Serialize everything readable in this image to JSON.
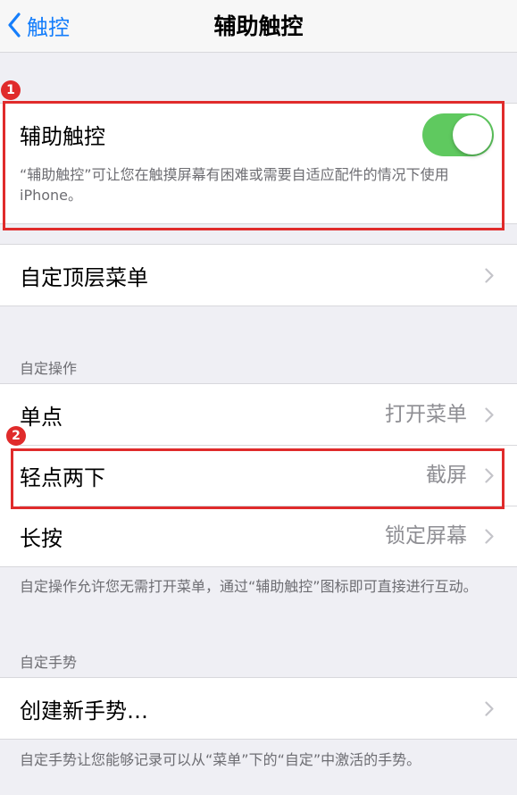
{
  "nav": {
    "back_label": "触控",
    "title": "辅助触控"
  },
  "assistive_touch": {
    "label": "辅助触控",
    "enabled": true,
    "footnote": "“辅助触控”可让您在触摸屏幕有困难或需要自适应配件的情况下使用iPhone。"
  },
  "top_menu": {
    "label": "自定顶层菜单"
  },
  "custom_actions": {
    "header": "自定操作",
    "rows": [
      {
        "label": "单点",
        "value": "打开菜单"
      },
      {
        "label": "轻点两下",
        "value": "截屏"
      },
      {
        "label": "长按",
        "value": "锁定屏幕"
      }
    ],
    "footnote": "自定操作允许您无需打开菜单，通过“辅助触控”图标即可直接进行互动。"
  },
  "custom_gestures": {
    "header": "自定手势",
    "create_label": "创建新手势…",
    "footnote": "自定手势让您能够记录可以从“菜单”下的“自定”中激活的手势。"
  },
  "annotations": {
    "badge_1": "1",
    "badge_2": "2"
  },
  "colors": {
    "accent": "#157efb",
    "toggle_on": "#5fc95f",
    "highlight": "#e02b2b"
  }
}
